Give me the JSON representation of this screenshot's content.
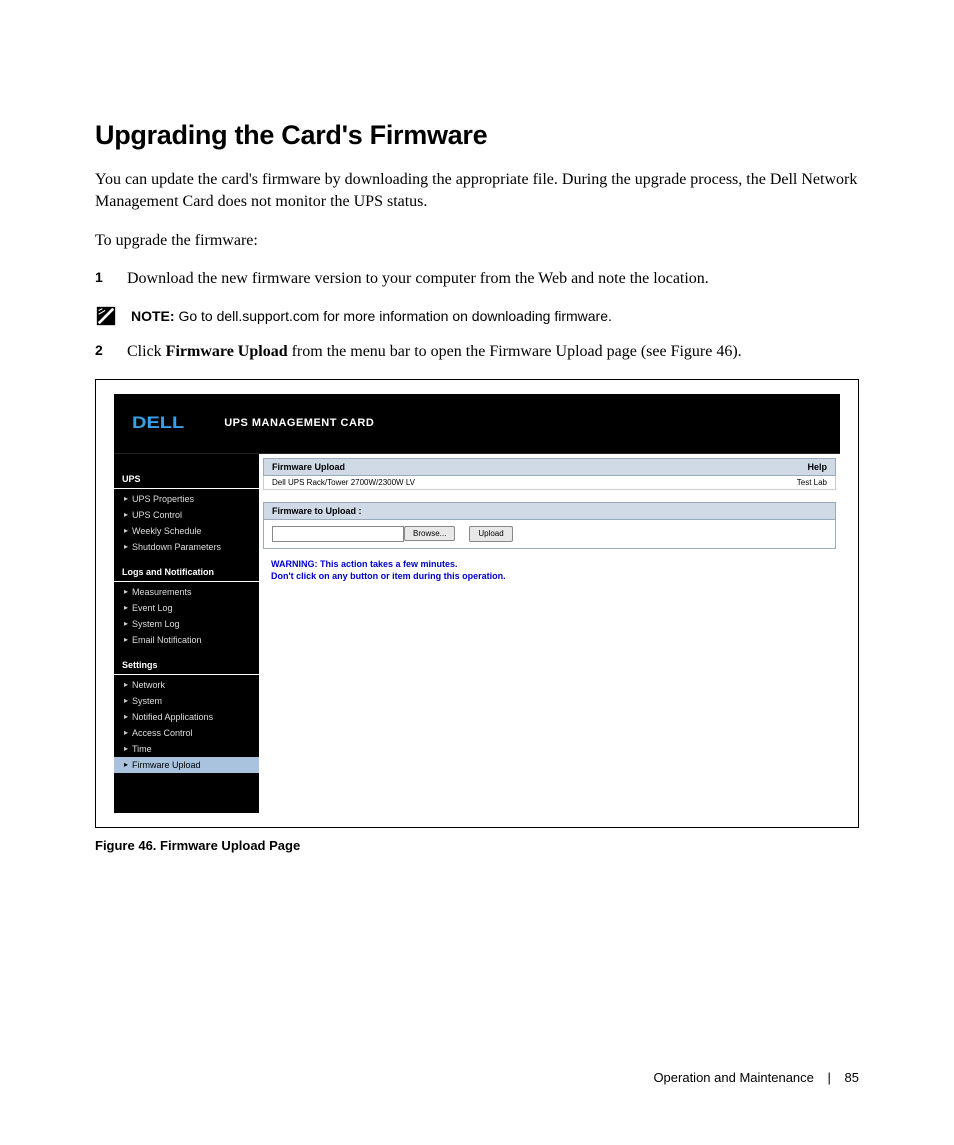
{
  "title": "Upgrading the Card's Firmware",
  "intro": "You can update the card's firmware by downloading the appropriate file. During the upgrade process, the Dell Network Management Card does not monitor the UPS status.",
  "lead": "To upgrade the firmware:",
  "steps": [
    {
      "num": "1",
      "text": "Download the new firmware version to your computer from the Web and note the location."
    },
    {
      "num": "2",
      "pre": "Click ",
      "bold": "Firmware Upload",
      "post": " from the menu bar to open the Firmware Upload page (see Figure 46)."
    }
  ],
  "note": {
    "label": "NOTE:",
    "text": " Go to dell.support.com for more information on downloading firmware."
  },
  "figure": {
    "brand_logo": "DELL",
    "app_title": "UPS MANAGEMENT CARD",
    "sidebar": {
      "groups": [
        {
          "title": "UPS",
          "items": [
            "UPS Properties",
            "UPS Control",
            "Weekly Schedule",
            "Shutdown Parameters"
          ]
        },
        {
          "title": "Logs and Notification",
          "items": [
            "Measurements",
            "Event Log",
            "System Log",
            "Email Notification"
          ]
        },
        {
          "title": "Settings",
          "items": [
            "Network",
            "System",
            "Notified Applications",
            "Access Control",
            "Time",
            "Firmware Upload"
          ]
        }
      ],
      "active": "Firmware Upload"
    },
    "main": {
      "header_left": "Firmware Upload",
      "header_right": "Help",
      "sub_left": "Dell UPS Rack/Tower 2700W/2300W LV",
      "sub_right": "Test Lab",
      "panel_title": "Firmware to Upload :",
      "browse": "Browse...",
      "upload": "Upload",
      "warn_line1": "WARNING: This action takes a few minutes.",
      "warn_line2": "Don't click on any button or item during this operation."
    },
    "caption": "Figure 46. Firmware Upload Page"
  },
  "footer": {
    "section": "Operation and Maintenance",
    "page": "85"
  }
}
